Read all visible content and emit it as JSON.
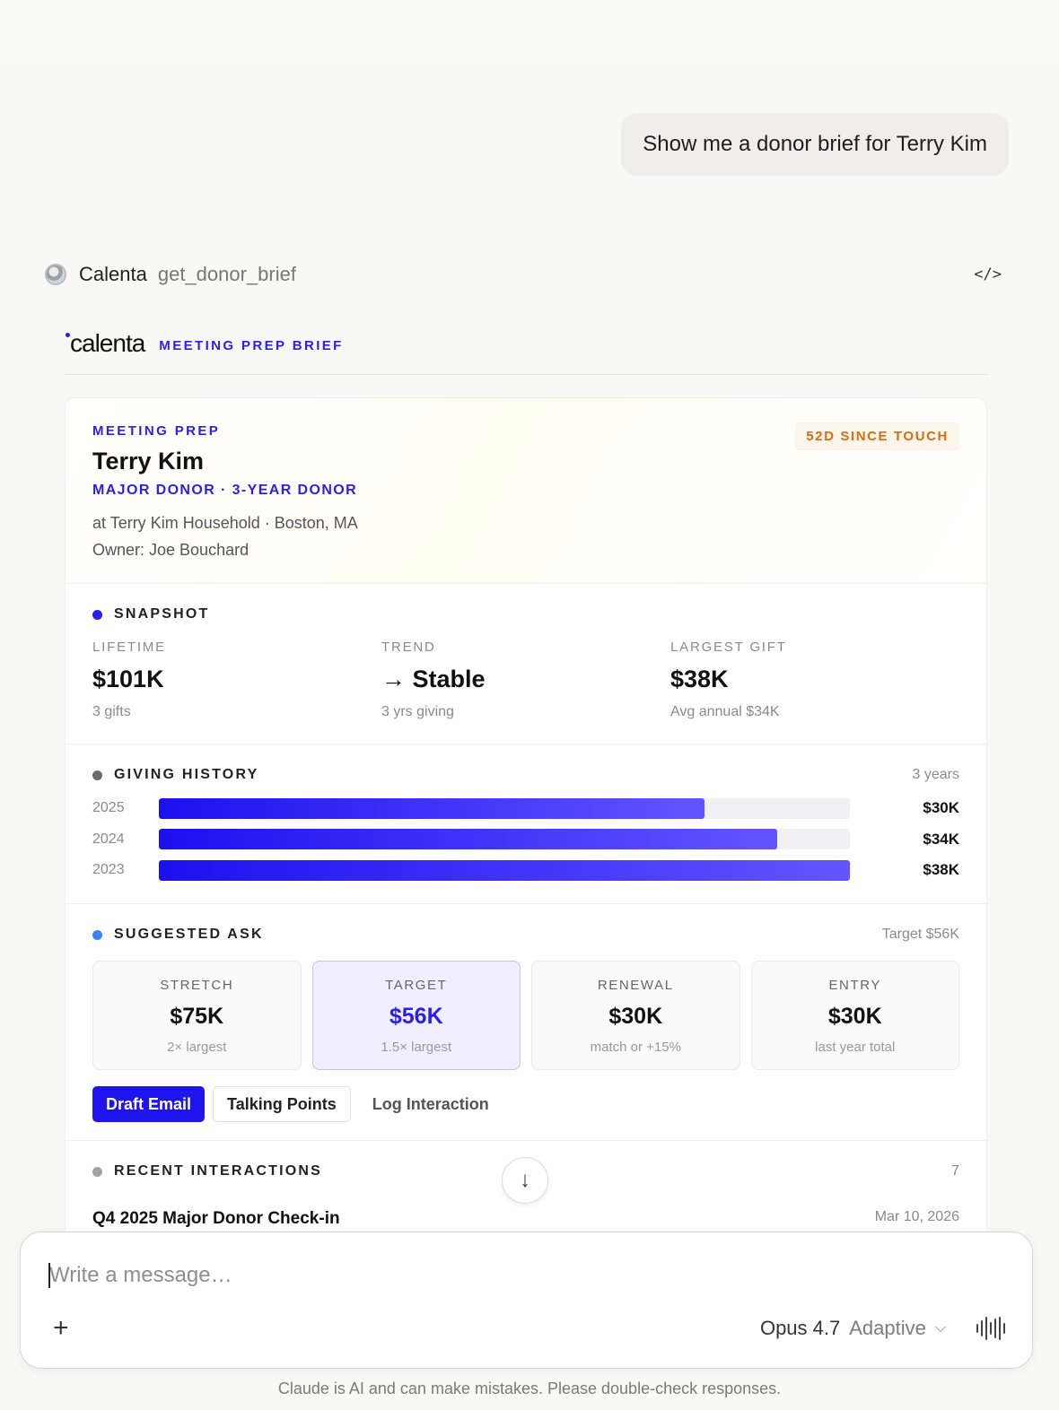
{
  "conversation": {
    "user_message": "Show me a donor brief for Terry Kim"
  },
  "tool_call": {
    "connector": "Calenta",
    "function": "get_donor_brief",
    "code_toggle_label": "</>"
  },
  "brand": {
    "logo": "calenta",
    "tagline": "MEETING PREP BRIEF",
    "accent_color": "#2a1ef0"
  },
  "donor": {
    "eyebrow": "MEETING PREP",
    "name": "Terry Kim",
    "tier": "MAJOR DONOR · 3-YEAR DONOR",
    "household": "at Terry Kim Household · Boston, MA",
    "owner": "Owner: Joe Bouchard",
    "touch_badge": "52D SINCE TOUCH"
  },
  "snapshot": {
    "title": "SNAPSHOT",
    "stats": [
      {
        "label": "LIFETIME",
        "value": "$101K",
        "sub": "3 gifts"
      },
      {
        "label": "TREND",
        "value": "→ Stable",
        "sub": "3 yrs giving"
      },
      {
        "label": "LARGEST GIFT",
        "value": "$38K",
        "sub": "Avg annual $34K"
      }
    ]
  },
  "giving_history": {
    "title": "GIVING HISTORY",
    "span": "3 years",
    "rows": [
      {
        "year": "2025",
        "amount": "$30K",
        "value": 30
      },
      {
        "year": "2024",
        "amount": "$34K",
        "value": 34
      },
      {
        "year": "2023",
        "amount": "$38K",
        "value": 38
      }
    ],
    "max_value": 38
  },
  "suggested_ask": {
    "title": "SUGGESTED ASK",
    "target_summary": "Target $56K",
    "tiers": [
      {
        "label": "STRETCH",
        "value": "$75K",
        "sub": "2× largest"
      },
      {
        "label": "TARGET",
        "value": "$56K",
        "sub": "1.5× largest",
        "active": true
      },
      {
        "label": "RENEWAL",
        "value": "$30K",
        "sub": "match or +15%"
      },
      {
        "label": "ENTRY",
        "value": "$30K",
        "sub": "last year total"
      }
    ],
    "actions": {
      "draft_email": "Draft Email",
      "talking_points": "Talking Points",
      "log_interaction": "Log Interaction"
    }
  },
  "recent_interactions": {
    "title": "RECENT INTERACTIONS",
    "count": "7",
    "items": [
      {
        "title": "Q4 2025 Major Donor Check-in",
        "date": "Mar 10, 2026"
      }
    ]
  },
  "composer": {
    "placeholder": "Write a message…",
    "model": "Opus 4.7",
    "mode": "Adaptive"
  },
  "footer": {
    "disclaimer": "Claude is AI and can make mistakes. Please double-check responses."
  }
}
